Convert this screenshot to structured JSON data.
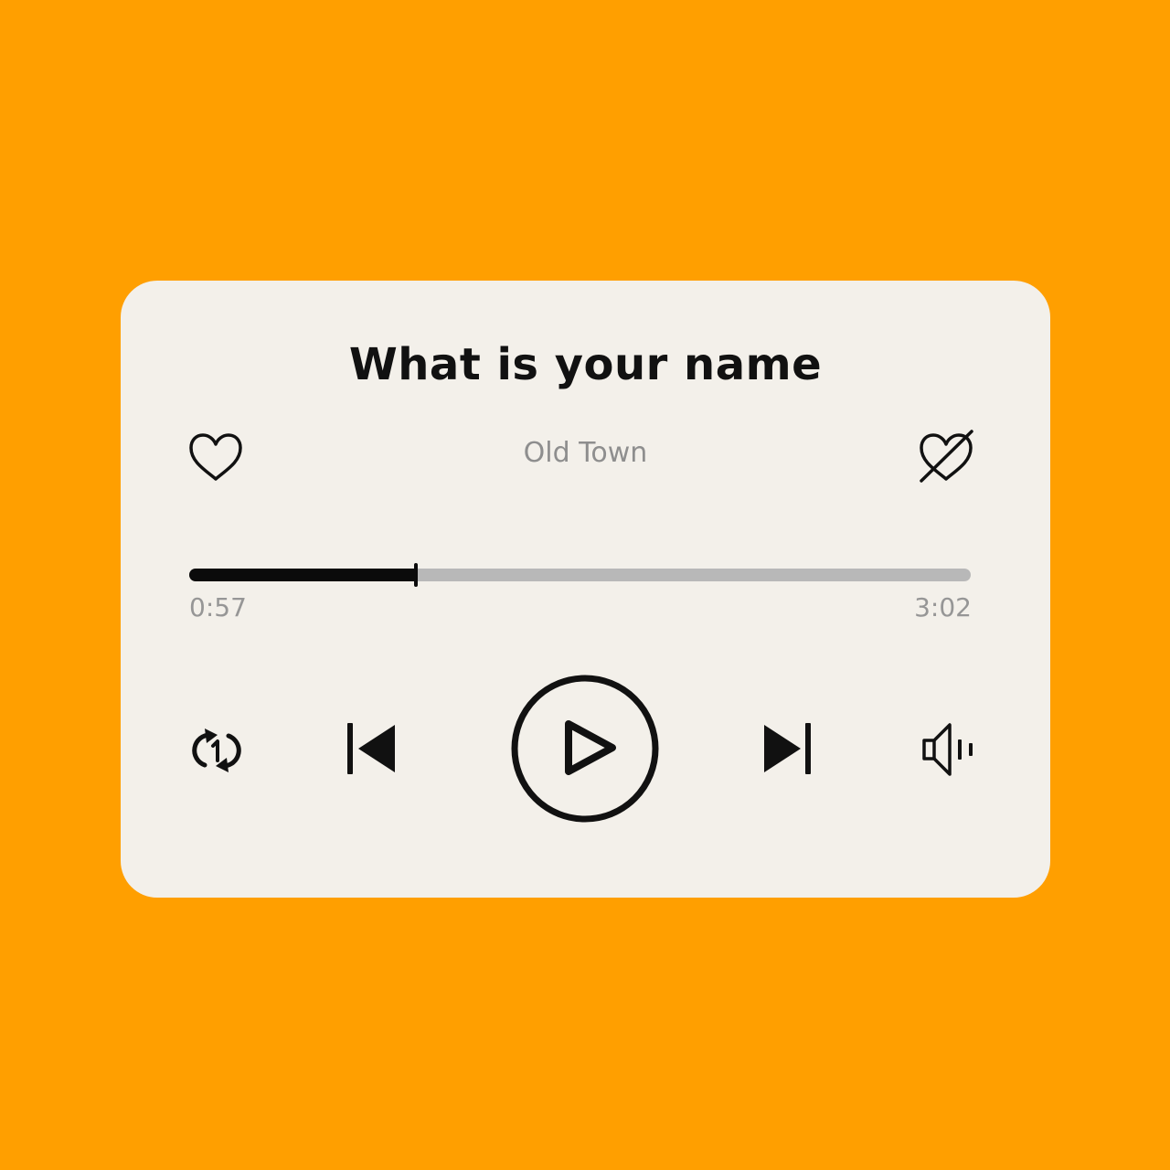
{
  "theme": {
    "background": "#FF9F00",
    "card": "#F3F0EA",
    "progress_played": "#0B0B0B",
    "progress_remaining": "#B8B8B8"
  },
  "track": {
    "title": "What is your name",
    "artist": "Old Town"
  },
  "progress": {
    "elapsed": "0:57",
    "total": "3:02",
    "fraction": 0.29
  },
  "icons": {
    "like": "heart-icon",
    "dislike": "heart-crossed-icon",
    "repeat": "repeat-one-icon",
    "previous": "skip-previous-icon",
    "play": "play-circle-icon",
    "next": "skip-next-icon",
    "volume": "speaker-volume-icon"
  }
}
